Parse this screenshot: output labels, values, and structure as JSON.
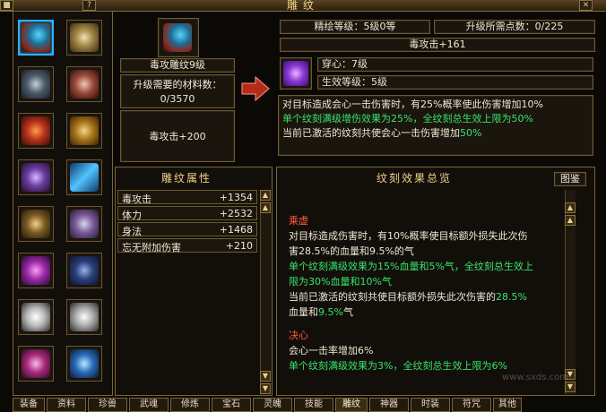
{
  "window": {
    "title": "雕纹",
    "close_icon": "✕",
    "help_icon": "?",
    "lock_icon": "■"
  },
  "left_grid": {
    "items": [
      {
        "name": "蓝宝石剑坠"
      },
      {
        "name": "戒指"
      },
      {
        "name": "铠甲"
      },
      {
        "name": "手镯"
      },
      {
        "name": "红色护符"
      },
      {
        "name": "卷轴"
      },
      {
        "name": "项链"
      },
      {
        "name": "蓝色剑"
      },
      {
        "name": "腰带"
      },
      {
        "name": "手套"
      },
      {
        "name": "紫色法器"
      },
      {
        "name": "靴子"
      },
      {
        "name": "白色面具"
      },
      {
        "name": "白色面具2"
      },
      {
        "name": "宝石项链"
      },
      {
        "name": "蓝色饰品"
      }
    ]
  },
  "carving": {
    "name": "毒攻雕纹9级",
    "need_label": "升级需要的材料数：",
    "need_value": "0/3570",
    "bonus": "毒攻击+200"
  },
  "stats": {
    "level_label": "精绘等级：5级0等",
    "points_label": "升级所需点数：0/225",
    "current_bonus": "毒攻击+161"
  },
  "effect": {
    "name_label": "穿心：7级",
    "active_label": "生效等级：5级",
    "desc_line1": "对目标造成会心一击伤害时，有25%概率使此伤害增加10%",
    "desc_line2": "单个纹刻满级增伤效果为25%，全纹刻总生效上限为50%",
    "desc_line3a": "当前已激活的纹刻共使会心一击伤害增加",
    "desc_line3b": "50%"
  },
  "attributes": {
    "header": "雕纹属性",
    "rows": [
      {
        "k": "毒攻击",
        "v": "+1354"
      },
      {
        "k": "体力",
        "v": "+2532"
      },
      {
        "k": "身法",
        "v": "+1468"
      },
      {
        "k": "忘无附加伤害",
        "v": "+210"
      }
    ]
  },
  "overview": {
    "header": "纹刻效果总览",
    "illustrate_button": "图鉴",
    "s1_title": "乘虚",
    "s1_l1": "对目标造成伤害时，有10%概率使目标额外损失此次伤",
    "s1_l2": "害28.5%的血量和9.5%的气",
    "s1_l3": "单个纹刻满级效果为15%血量和5%气，全纹刻总生效上",
    "s1_l4": "限为30%血量和10%气",
    "s1_l5a": "当前已激活的纹刻共使目标额外损失此次伤害的",
    "s1_l5b": "28.5%",
    "s1_l6a": "血量和",
    "s1_l6b": "9.5%",
    "s1_l6c": "气",
    "s2_title": "决心",
    "s2_l1": "会心一击率增加6%",
    "s2_l2": "单个纹刻满级效果为3%，全纹刻总生效上限为6%"
  },
  "bottom_tabs": [
    "装备",
    "资料",
    "珍兽",
    "武魂",
    "修炼",
    "宝石",
    "灵魄",
    "技能",
    "雕纹",
    "神器",
    "时装",
    "符咒",
    "其他"
  ],
  "watermark": "www.sxds.com",
  "colors": {
    "accent_gold": "#f1d28a",
    "green": "#39e36b",
    "red": "#ff5a3a",
    "select_blue": "#2bb3ff"
  }
}
